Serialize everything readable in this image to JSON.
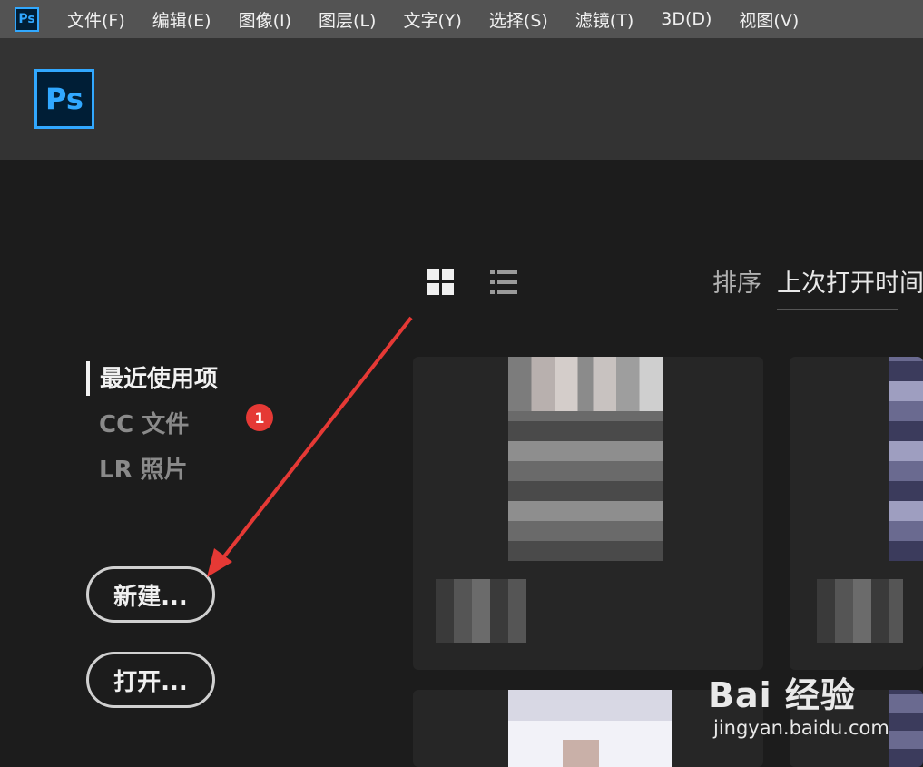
{
  "app": {
    "icon_label": "Ps"
  },
  "menu": [
    {
      "label": "文件(F)"
    },
    {
      "label": "编辑(E)"
    },
    {
      "label": "图像(I)"
    },
    {
      "label": "图层(L)"
    },
    {
      "label": "文字(Y)"
    },
    {
      "label": "选择(S)"
    },
    {
      "label": "滤镜(T)"
    },
    {
      "label": "3D(D)"
    },
    {
      "label": "视图(V)"
    }
  ],
  "header": {
    "logo_label": "Ps"
  },
  "sidebar": {
    "items": [
      {
        "label": "最近使用项",
        "active": true
      },
      {
        "label": "CC 文件",
        "active": false
      },
      {
        "label": "LR 照片",
        "active": false
      }
    ],
    "new_button": "新建...",
    "open_button": "打开..."
  },
  "annotation": {
    "badge": "1"
  },
  "toolbar": {
    "grid_view_icon": "grid-icon",
    "list_view_icon": "list-icon",
    "sort_label": "排序",
    "sort_value": "上次打开时间"
  },
  "watermark": {
    "logo": "Bai 经验",
    "url": "jingyan.baidu.com"
  },
  "colors": {
    "accent": "#31a8ff",
    "arrow": "#e53935"
  }
}
